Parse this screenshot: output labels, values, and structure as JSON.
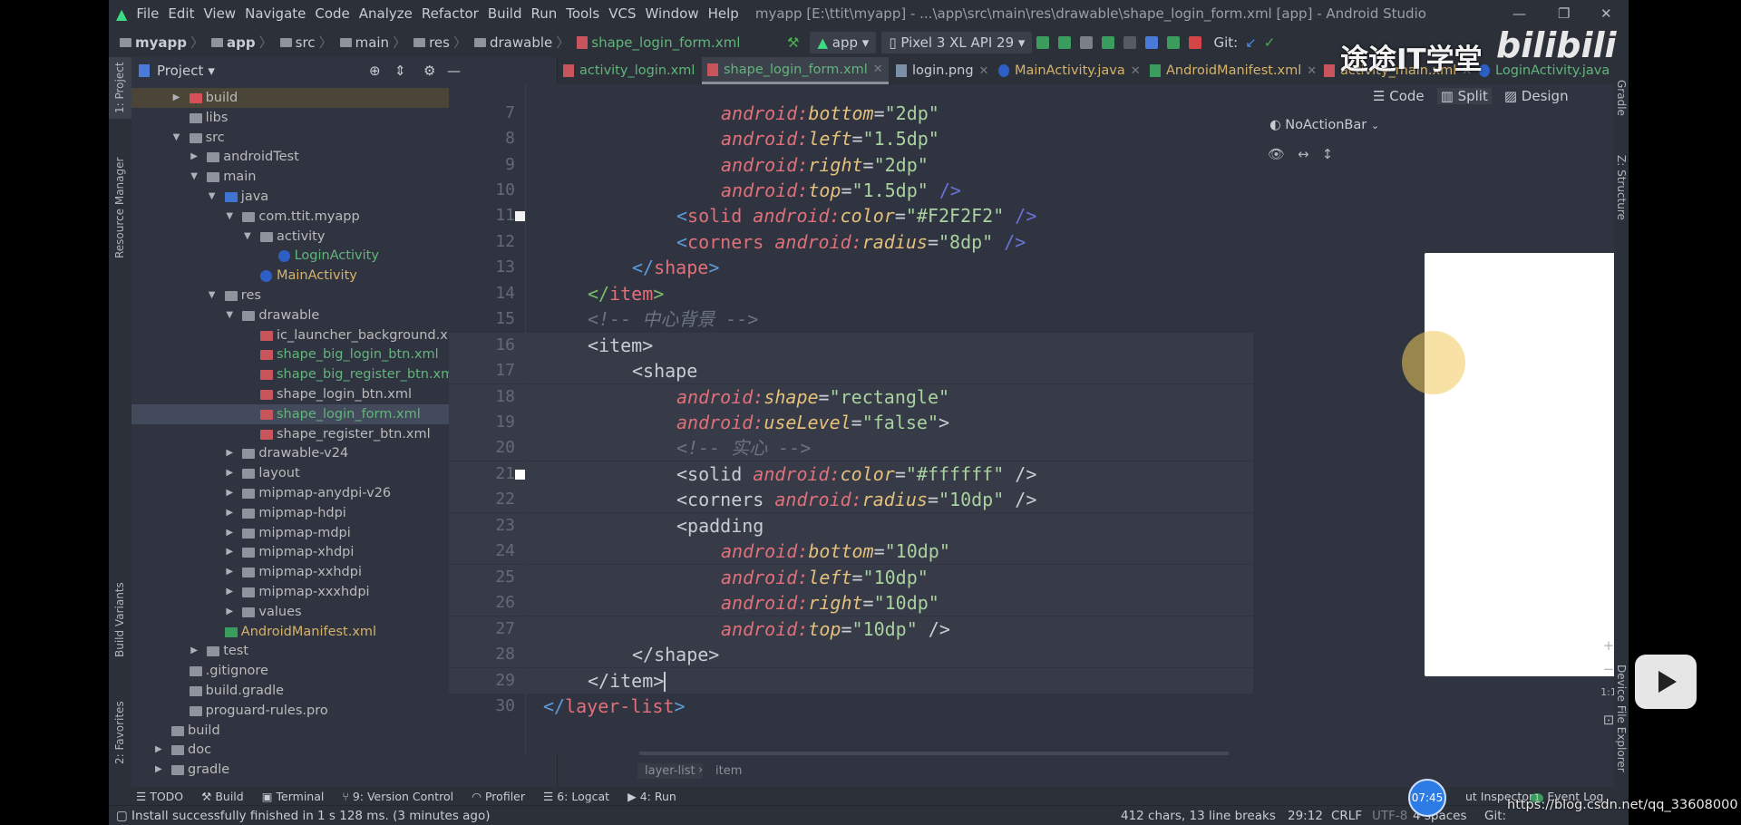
{
  "window": {
    "title": "myapp [E:\\ttit\\myapp] - ...\\app\\src\\main\\res\\drawable\\shape_login_form.xml [app] - Android Studio",
    "menu": [
      "File",
      "Edit",
      "View",
      "Navigate",
      "Code",
      "Analyze",
      "Refactor",
      "Build",
      "Run",
      "Tools",
      "VCS",
      "Window",
      "Help"
    ]
  },
  "navbar": {
    "breadcrumbs": [
      "myapp",
      "app",
      "src",
      "main",
      "res",
      "drawable",
      "shape_login_form.xml"
    ],
    "run_config": "app",
    "device": "Pixel 3 XL API 29",
    "git_label": "Git:"
  },
  "project": {
    "title": "Project",
    "tree": [
      {
        "label": "build",
        "level": 1,
        "arrow": "▶",
        "icon": "folder-red",
        "color": "#bbbbbb",
        "highlight": true
      },
      {
        "label": "libs",
        "level": 1,
        "arrow": "",
        "icon": "folder",
        "color": "#bbbbbb"
      },
      {
        "label": "src",
        "level": 1,
        "arrow": "▼",
        "icon": "folder",
        "color": "#bbbbbb"
      },
      {
        "label": "androidTest",
        "level": 2,
        "arrow": "▶",
        "icon": "folder",
        "color": "#bbbbbb"
      },
      {
        "label": "main",
        "level": 2,
        "arrow": "▼",
        "icon": "folder",
        "color": "#bbbbbb"
      },
      {
        "label": "java",
        "level": 3,
        "arrow": "▼",
        "icon": "folder-blue",
        "color": "#bbbbbb"
      },
      {
        "label": "com.ttit.myapp",
        "level": 4,
        "arrow": "▼",
        "icon": "package",
        "color": "#bbbbbb"
      },
      {
        "label": "activity",
        "level": 5,
        "arrow": "▼",
        "icon": "package",
        "color": "#bbbbbb"
      },
      {
        "label": "LoginActivity",
        "level": 6,
        "arrow": "",
        "icon": "class",
        "color": "#62b57a"
      },
      {
        "label": "MainActivity",
        "level": 5,
        "arrow": "",
        "icon": "class",
        "color": "#d6b36a"
      },
      {
        "label": "res",
        "level": 3,
        "arrow": "▼",
        "icon": "folder",
        "color": "#bbbbbb"
      },
      {
        "label": "drawable",
        "level": 4,
        "arrow": "▼",
        "icon": "folder",
        "color": "#bbbbbb"
      },
      {
        "label": "ic_launcher_background.xml",
        "level": 5,
        "arrow": "",
        "icon": "xml",
        "color": "#bbbbbb"
      },
      {
        "label": "shape_big_login_btn.xml",
        "level": 5,
        "arrow": "",
        "icon": "xml",
        "color": "#62b57a"
      },
      {
        "label": "shape_big_register_btn.xml",
        "level": 5,
        "arrow": "",
        "icon": "xml",
        "color": "#62b57a"
      },
      {
        "label": "shape_login_btn.xml",
        "level": 5,
        "arrow": "",
        "icon": "xml",
        "color": "#bbbbbb"
      },
      {
        "label": "shape_login_form.xml",
        "level": 5,
        "arrow": "",
        "icon": "xml",
        "color": "#62b57a",
        "selected": true
      },
      {
        "label": "shape_register_btn.xml",
        "level": 5,
        "arrow": "",
        "icon": "xml",
        "color": "#bbbbbb"
      },
      {
        "label": "drawable-v24",
        "level": 4,
        "arrow": "▶",
        "icon": "folder",
        "color": "#bbbbbb"
      },
      {
        "label": "layout",
        "level": 4,
        "arrow": "▶",
        "icon": "folder",
        "color": "#bbbbbb"
      },
      {
        "label": "mipmap-anydpi-v26",
        "level": 4,
        "arrow": "▶",
        "icon": "folder",
        "color": "#bbbbbb"
      },
      {
        "label": "mipmap-hdpi",
        "level": 4,
        "arrow": "▶",
        "icon": "folder",
        "color": "#bbbbbb"
      },
      {
        "label": "mipmap-mdpi",
        "level": 4,
        "arrow": "▶",
        "icon": "folder",
        "color": "#bbbbbb"
      },
      {
        "label": "mipmap-xhdpi",
        "level": 4,
        "arrow": "▶",
        "icon": "folder",
        "color": "#bbbbbb"
      },
      {
        "label": "mipmap-xxhdpi",
        "level": 4,
        "arrow": "▶",
        "icon": "folder",
        "color": "#bbbbbb"
      },
      {
        "label": "mipmap-xxxhdpi",
        "level": 4,
        "arrow": "▶",
        "icon": "folder",
        "color": "#bbbbbb"
      },
      {
        "label": "values",
        "level": 4,
        "arrow": "▶",
        "icon": "folder",
        "color": "#bbbbbb"
      },
      {
        "label": "AndroidManifest.xml",
        "level": 3,
        "arrow": "",
        "icon": "manifest",
        "color": "#d6b36a"
      },
      {
        "label": "test",
        "level": 2,
        "arrow": "▶",
        "icon": "folder",
        "color": "#bbbbbb"
      },
      {
        "label": ".gitignore",
        "level": 1,
        "arrow": "",
        "icon": "file",
        "color": "#bbbbbb"
      },
      {
        "label": "build.gradle",
        "level": 1,
        "arrow": "",
        "icon": "gradle",
        "color": "#bbbbbb"
      },
      {
        "label": "proguard-rules.pro",
        "level": 1,
        "arrow": "",
        "icon": "file",
        "color": "#bbbbbb"
      },
      {
        "label": "build",
        "level": 0,
        "arrow": "",
        "icon": "folder",
        "color": "#bbbbbb"
      },
      {
        "label": "doc",
        "level": 0,
        "arrow": "▶",
        "icon": "folder",
        "color": "#bbbbbb"
      },
      {
        "label": "gradle",
        "level": 0,
        "arrow": "▶",
        "icon": "folder",
        "color": "#bbbbbb"
      }
    ]
  },
  "tabs": [
    {
      "label": "activity_login.xml",
      "color": "#62b57a",
      "icon": "xml"
    },
    {
      "label": "shape_login_form.xml",
      "color": "#62b57a",
      "icon": "xml",
      "active": true
    },
    {
      "label": "login.png",
      "color": "#c9ccd2",
      "icon": "image"
    },
    {
      "label": "MainActivity.java",
      "color": "#d6b36a",
      "icon": "class"
    },
    {
      "label": "AndroidManifest.xml",
      "color": "#d6b36a",
      "icon": "manifest"
    },
    {
      "label": "activity_main.xml",
      "color": "#d6b36a",
      "icon": "xml"
    },
    {
      "label": "LoginActivity.java",
      "color": "#62b57a",
      "icon": "class"
    }
  ],
  "editor": {
    "lines": [
      {
        "n": "7",
        "indent": 4,
        "tokens": [
          [
            "t-ns",
            "android:"
          ],
          [
            "t-attr",
            "bottom"
          ],
          [
            "t-eq",
            "="
          ],
          [
            "t-str",
            "\"2dp\""
          ]
        ]
      },
      {
        "n": "8",
        "indent": 4,
        "tokens": [
          [
            "t-ns",
            "android:"
          ],
          [
            "t-attr",
            "left"
          ],
          [
            "t-eq",
            "="
          ],
          [
            "t-str",
            "\"1.5dp\""
          ]
        ]
      },
      {
        "n": "9",
        "indent": 4,
        "tokens": [
          [
            "t-ns",
            "android:"
          ],
          [
            "t-attr",
            "right"
          ],
          [
            "t-eq",
            "="
          ],
          [
            "t-str",
            "\"2dp\""
          ]
        ]
      },
      {
        "n": "10",
        "indent": 4,
        "tokens": [
          [
            "t-ns",
            "android:"
          ],
          [
            "t-attr",
            "top"
          ],
          [
            "t-eq",
            "="
          ],
          [
            "t-str",
            "\"1.5dp\""
          ],
          [
            "t-end",
            " />"
          ]
        ]
      },
      {
        "n": "11",
        "indent": 3,
        "swatch": "#F2F2F2",
        "tokens": [
          [
            "t-br",
            "<"
          ],
          [
            "t-tag",
            "solid "
          ],
          [
            "t-ns",
            "android:"
          ],
          [
            "t-attr",
            "color"
          ],
          [
            "t-eq",
            "="
          ],
          [
            "t-str",
            "\"#F2F2F2\""
          ],
          [
            "t-end",
            " />"
          ]
        ]
      },
      {
        "n": "12",
        "indent": 3,
        "tokens": [
          [
            "t-br",
            "<"
          ],
          [
            "t-tag",
            "corners "
          ],
          [
            "t-ns",
            "android:"
          ],
          [
            "t-attr",
            "radius"
          ],
          [
            "t-eq",
            "="
          ],
          [
            "t-str",
            "\"8dp\""
          ],
          [
            "t-end",
            " />"
          ]
        ]
      },
      {
        "n": "13",
        "indent": 2,
        "tokens": [
          [
            "t-br",
            "</"
          ],
          [
            "t-tag",
            "shape"
          ],
          [
            "t-br",
            ">"
          ]
        ]
      },
      {
        "n": "14",
        "indent": 1,
        "tokens": [
          [
            "t-gbr",
            "</"
          ],
          [
            "t-tag",
            "item"
          ],
          [
            "t-gbr",
            ">"
          ]
        ]
      },
      {
        "n": "15",
        "indent": 1,
        "tokens": [
          [
            "t-cm",
            "<!-- 中心背景 -->"
          ]
        ]
      },
      {
        "n": "16",
        "indent": 1,
        "hl": true,
        "tokens": [
          [
            "t-eq",
            "<item>"
          ]
        ]
      },
      {
        "n": "17",
        "indent": 2,
        "hl": true,
        "tokens": [
          [
            "t-eq",
            "<shape"
          ]
        ]
      },
      {
        "n": "18",
        "indent": 3,
        "hl": true,
        "tokens": [
          [
            "t-ns",
            "android:"
          ],
          [
            "t-attr",
            "shape"
          ],
          [
            "t-eq",
            "="
          ],
          [
            "t-str",
            "\"rectangle\""
          ]
        ]
      },
      {
        "n": "19",
        "indent": 3,
        "hl": true,
        "tokens": [
          [
            "t-ns",
            "android:"
          ],
          [
            "t-attr",
            "useLevel"
          ],
          [
            "t-eq",
            "="
          ],
          [
            "t-str",
            "\"false\""
          ],
          [
            "t-eq",
            ">"
          ]
        ]
      },
      {
        "n": "20",
        "indent": 3,
        "hl": true,
        "tokens": [
          [
            "t-cm",
            "<!-- 实心 -->"
          ]
        ]
      },
      {
        "n": "21",
        "indent": 3,
        "hl": true,
        "swatch": "#ffffff",
        "tokens": [
          [
            "t-eq",
            "<solid "
          ],
          [
            "t-ns",
            "android:"
          ],
          [
            "t-attr",
            "color"
          ],
          [
            "t-eq",
            "="
          ],
          [
            "t-str",
            "\"#ffffff\""
          ],
          [
            "t-eq",
            " />"
          ]
        ]
      },
      {
        "n": "22",
        "indent": 3,
        "hl": true,
        "tokens": [
          [
            "t-eq",
            "<corners "
          ],
          [
            "t-ns",
            "android:"
          ],
          [
            "t-attr",
            "radius"
          ],
          [
            "t-eq",
            "="
          ],
          [
            "t-str",
            "\"10dp\""
          ],
          [
            "t-eq",
            " />"
          ]
        ]
      },
      {
        "n": "23",
        "indent": 3,
        "hl": true,
        "tokens": [
          [
            "t-eq",
            "<padding"
          ]
        ]
      },
      {
        "n": "24",
        "indent": 4,
        "hl": true,
        "tokens": [
          [
            "t-ns",
            "android:"
          ],
          [
            "t-attr",
            "bottom"
          ],
          [
            "t-eq",
            "="
          ],
          [
            "t-str",
            "\"10dp\""
          ]
        ]
      },
      {
        "n": "25",
        "indent": 4,
        "hl": true,
        "tokens": [
          [
            "t-ns",
            "android:"
          ],
          [
            "t-attr",
            "left"
          ],
          [
            "t-eq",
            "="
          ],
          [
            "t-str",
            "\"10dp\""
          ]
        ]
      },
      {
        "n": "26",
        "indent": 4,
        "hl": true,
        "tokens": [
          [
            "t-ns",
            "android:"
          ],
          [
            "t-attr",
            "right"
          ],
          [
            "t-eq",
            "="
          ],
          [
            "t-str",
            "\"10dp\""
          ]
        ]
      },
      {
        "n": "27",
        "indent": 4,
        "hl": true,
        "tokens": [
          [
            "t-ns",
            "android:"
          ],
          [
            "t-attr",
            "top"
          ],
          [
            "t-eq",
            "="
          ],
          [
            "t-str",
            "\"10dp\""
          ],
          [
            "t-eq",
            " />"
          ]
        ]
      },
      {
        "n": "28",
        "indent": 2,
        "hl": true,
        "tokens": [
          [
            "t-eq",
            "</shape>"
          ]
        ]
      },
      {
        "n": "29",
        "indent": 1,
        "hl": true,
        "tokens": [
          [
            "t-eq",
            "</item>"
          ]
        ]
      },
      {
        "n": "30",
        "indent": 0,
        "tokens": [
          [
            "t-br",
            "</"
          ],
          [
            "t-tag",
            "layer-list"
          ],
          [
            "t-br",
            ">"
          ]
        ]
      }
    ],
    "breadcrumb": [
      "layer-list",
      "item"
    ]
  },
  "preview": {
    "theme": "NoActionBar",
    "modes": [
      "Code",
      "Split",
      "Design"
    ],
    "active_mode": "Split",
    "zoom_controls": [
      "+",
      "−",
      "1:1"
    ]
  },
  "side_stripes": {
    "left": [
      "1: Project",
      "Resource Manager",
      "Build Variants",
      "2: Favorites"
    ],
    "right": [
      "Gradle",
      "Z: Structure",
      "Device File Explorer"
    ]
  },
  "tool_windows": [
    "TODO",
    "Build",
    "Terminal",
    "9: Version Control",
    "Profiler",
    "6: Logcat",
    "4: Run"
  ],
  "tool_windows_right": {
    "layout_inspector": "ut Inspector",
    "event_log": "Event Log",
    "event_count": "1"
  },
  "status": {
    "message": "Install successfully finished in 1 s 128 ms. (3 minutes ago)",
    "chars": "412 chars, 13 line breaks",
    "position": "29:12",
    "line_sep": "CRLF",
    "encoding": "UTF-8",
    "indent": "4 spaces",
    "git": "Git:"
  },
  "overlay": {
    "watermark": "途途IT学堂",
    "logo": "bilibili",
    "timer": "07:45",
    "url": "https://blog.csdn.net/qq_33608000"
  }
}
